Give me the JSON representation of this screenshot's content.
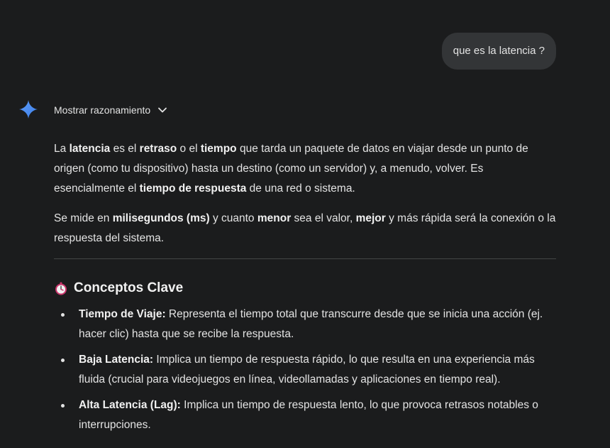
{
  "user_message": "que es la latencia ?",
  "reasoning_toggle": {
    "label": "Mostrar razonamiento"
  },
  "answer": {
    "para1": {
      "t1": "La ",
      "b1": "latencia",
      "t2": " es el ",
      "b2": "retraso",
      "t3": " o el ",
      "b3": "tiempo",
      "t4": " que tarda un paquete de datos en viajar desde un punto de origen (como tu dispositivo) hasta un destino (como un servidor) y, a menudo, volver. Es esencialmente el ",
      "b4": "tiempo de respuesta",
      "t5": " de una red o sistema."
    },
    "para2": {
      "t1": "Se mide en ",
      "b1": "milisegundos (ms)",
      "t2": " y cuanto ",
      "b2": "menor",
      "t3": " sea el valor, ",
      "b3": "mejor",
      "t4": " y más rápida será la conexión o la respuesta del sistema."
    },
    "section_title": "Conceptos Clave",
    "bullets": [
      {
        "term": "Tiempo de Viaje:",
        "text": " Representa el tiempo total que transcurre desde que se inicia una acción (ej. hacer clic) hasta que se recibe la respuesta."
      },
      {
        "term": "Baja Latencia:",
        "text": " Implica un tiempo de respuesta rápido, lo que resulta en una experiencia más fluida (crucial para videojuegos en línea, videollamadas y aplicaciones en tiempo real)."
      },
      {
        "term": "Alta Latencia (Lag):",
        "text": " Implica un tiempo de respuesta lento, lo que provoca retrasos notables o interrupciones."
      }
    ]
  },
  "icons": {
    "assistant": "gemini-sparkle-icon",
    "toggle": "chevron-down-icon",
    "section": "stopwatch-emoji-icon"
  },
  "colors": {
    "background": "#1b1c1d",
    "user_bubble": "#333537",
    "text": "#e3e3e3",
    "sparkle_blue": "#4a8ff7"
  }
}
